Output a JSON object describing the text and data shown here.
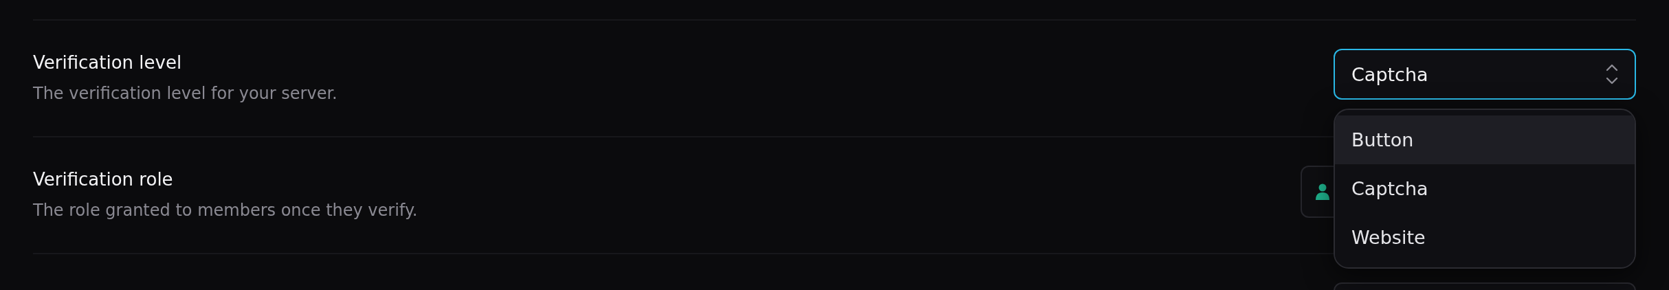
{
  "settings": [
    {
      "title": "Verification level",
      "description": "The verification level for your server.",
      "control": {
        "kind": "select",
        "value": "Captcha",
        "focused": true,
        "expanded": true,
        "options": [
          {
            "label": "Button",
            "highlighted": true
          },
          {
            "label": "Captcha",
            "highlighted": false
          },
          {
            "label": "Website",
            "highlighted": false
          }
        ]
      }
    },
    {
      "title": "Verification role",
      "description": "The role granted to members once they verify.",
      "control": {
        "kind": "role_select"
      }
    },
    {
      "control": {
        "kind": "select",
        "focused": false
      }
    }
  ]
}
